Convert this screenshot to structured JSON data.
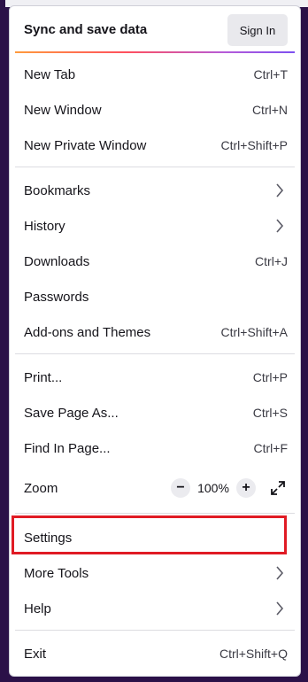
{
  "header": {
    "title": "Sync and save data",
    "sign_in_label": "Sign In"
  },
  "groups": {
    "windows": [
      {
        "label": "New Tab",
        "shortcut": "Ctrl+T"
      },
      {
        "label": "New Window",
        "shortcut": "Ctrl+N"
      },
      {
        "label": "New Private Window",
        "shortcut": "Ctrl+Shift+P"
      }
    ],
    "library": [
      {
        "label": "Bookmarks",
        "icon": "chevron-right-icon"
      },
      {
        "label": "History",
        "icon": "chevron-right-icon"
      },
      {
        "label": "Downloads",
        "shortcut": "Ctrl+J"
      },
      {
        "label": "Passwords"
      },
      {
        "label": "Add-ons and Themes",
        "shortcut": "Ctrl+Shift+A"
      }
    ],
    "page": [
      {
        "label": "Print...",
        "shortcut": "Ctrl+P"
      },
      {
        "label": "Save Page As...",
        "shortcut": "Ctrl+S"
      },
      {
        "label": "Find In Page...",
        "shortcut": "Ctrl+F"
      }
    ],
    "zoom": {
      "label": "Zoom",
      "minus": "−",
      "value": "100%",
      "plus": "+",
      "fullscreen_icon": "fullscreen-icon"
    },
    "tools": [
      {
        "label": "Settings"
      },
      {
        "label": "More Tools",
        "icon": "chevron-right-icon"
      },
      {
        "label": "Help",
        "icon": "chevron-right-icon"
      }
    ],
    "exit": {
      "label": "Exit",
      "shortcut": "Ctrl+Shift+Q"
    }
  },
  "annotation": {
    "highlight_color": "#e01b24",
    "highlighted_item": "Settings"
  },
  "colors": {
    "menu_background": "#ffffff",
    "window_background": "#2b1148",
    "sign_in_background": "#e9e9ed",
    "separator": "#dcdce1"
  }
}
